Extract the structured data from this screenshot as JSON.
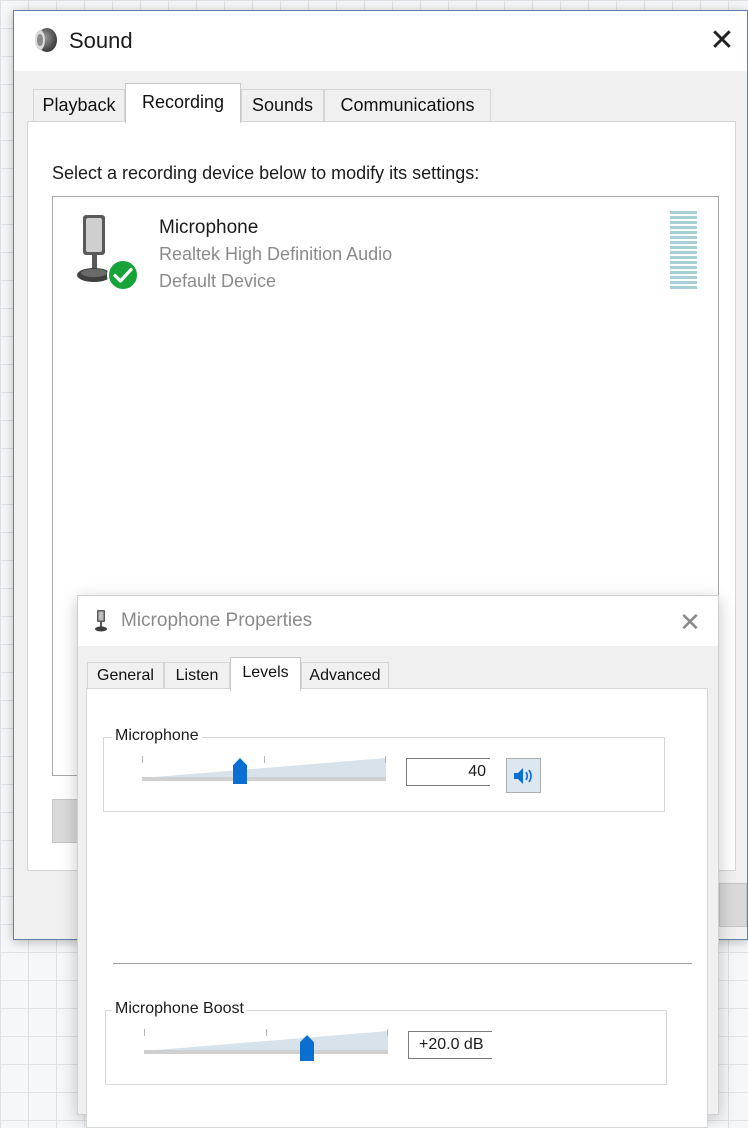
{
  "sound": {
    "title": "Sound",
    "close_glyph": "✕",
    "tabs": [
      "Playback",
      "Recording",
      "Sounds",
      "Communications"
    ],
    "active_tab": "Recording",
    "instruction": "Select a recording device below to modify its settings:",
    "device": {
      "name": "Microphone",
      "driver": "Realtek High Definition Audio",
      "status": "Default Device",
      "icon": "microphone-icon",
      "badge_icon": "check-icon"
    }
  },
  "properties": {
    "title": "Microphone Properties",
    "close_glyph": "✕",
    "tabs": [
      "General",
      "Listen",
      "Levels",
      "Advanced"
    ],
    "active_tab": "Levels",
    "microphone": {
      "label": "Microphone",
      "value": "40",
      "level_percent": 40,
      "mute_icon": "speaker-icon"
    },
    "boost": {
      "label": "Microphone Boost",
      "value": "+20.0 dB",
      "level_fraction": 0.67
    }
  },
  "colors": {
    "accent": "#0a6fd1",
    "check_badge": "#18a339",
    "meter": "#a7d0d6"
  }
}
